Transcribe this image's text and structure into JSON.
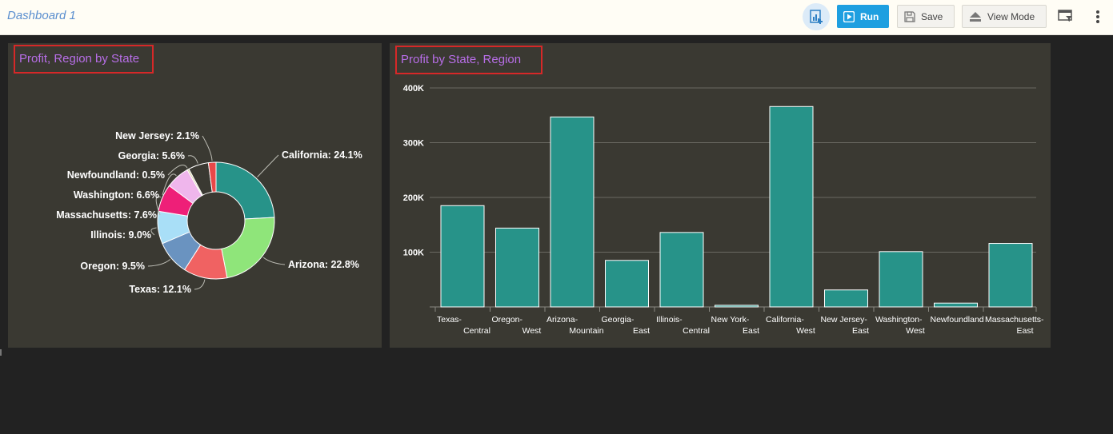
{
  "header": {
    "title": "Dashboard 1",
    "run_label": "Run",
    "save_label": "Save",
    "view_mode_label": "View Mode"
  },
  "icons": {
    "analytics": "chart-add-icon",
    "run": "play-icon",
    "save": "floppy-disk-icon",
    "view_mode": "eject-icon",
    "filter": "filter-panel-icon",
    "more": "vertical-dots-icon"
  },
  "colors": {
    "accent": "#1e9fe0",
    "panel_bg": "#3a3932",
    "title": "#b86ee8",
    "title_border": "#d62828",
    "bar": "#279389"
  },
  "charts": {
    "pie_title": "Profit, Region by State",
    "bar_title": "Profit by State, Region"
  },
  "chart_data": [
    {
      "type": "pie",
      "title": "Profit, Region by State",
      "donut": true,
      "slices": [
        {
          "label": "California",
          "text": "California: 24.1%",
          "value": 24.1,
          "color": "#279389"
        },
        {
          "label": "Arizona",
          "text": "Arizona: 22.8%",
          "value": 22.8,
          "color": "#8fe57a"
        },
        {
          "label": "Texas",
          "text": "Texas: 12.1%",
          "value": 12.1,
          "color": "#f06262"
        },
        {
          "label": "Oregon",
          "text": "Oregon: 9.5%",
          "value": 9.5,
          "color": "#6a93c0"
        },
        {
          "label": "Illinois",
          "text": "Illinois: 9.0%",
          "value": 9.0,
          "color": "#a9dff7"
        },
        {
          "label": "Massachusetts",
          "text": "Massachusetts: 7.6%",
          "value": 7.6,
          "color": "#ee1f78"
        },
        {
          "label": "Washington",
          "text": "Washington: 6.6%",
          "value": 6.6,
          "color": "#efb6ec"
        },
        {
          "label": "Newfoundland",
          "text": "Newfoundland: 0.5%",
          "value": 0.5,
          "color": "#d6cfa0"
        },
        {
          "label": "Georgia",
          "text": "Georgia: 5.6%",
          "value": 5.6,
          "color": "#3a3932"
        },
        {
          "label": "New Jersey",
          "text": "New Jersey: 2.1%",
          "value": 2.1,
          "color": "#e84848"
        }
      ]
    },
    {
      "type": "bar",
      "title": "Profit by State, Region",
      "categories": [
        [
          "Texas-",
          "Central"
        ],
        [
          "Oregon-",
          "West"
        ],
        [
          "Arizona-",
          "Mountain"
        ],
        [
          "Georgia-",
          "East"
        ],
        [
          "Illinois-",
          "Central"
        ],
        [
          "New York-",
          "East"
        ],
        [
          "California-",
          "West"
        ],
        [
          "New Jersey-",
          "East"
        ],
        [
          "Washington-",
          "West"
        ],
        [
          "Newfoundland",
          ""
        ],
        [
          "Massachusetts-",
          "East"
        ]
      ],
      "values": [
        185000,
        144000,
        347000,
        85000,
        136000,
        3000,
        366000,
        31000,
        101000,
        7000,
        116000
      ],
      "ylim": [
        0,
        400000
      ],
      "yticks": [
        100000,
        200000,
        300000,
        400000
      ],
      "ytick_labels": [
        "100K",
        "200K",
        "300K",
        "400K"
      ],
      "grid": true
    }
  ]
}
